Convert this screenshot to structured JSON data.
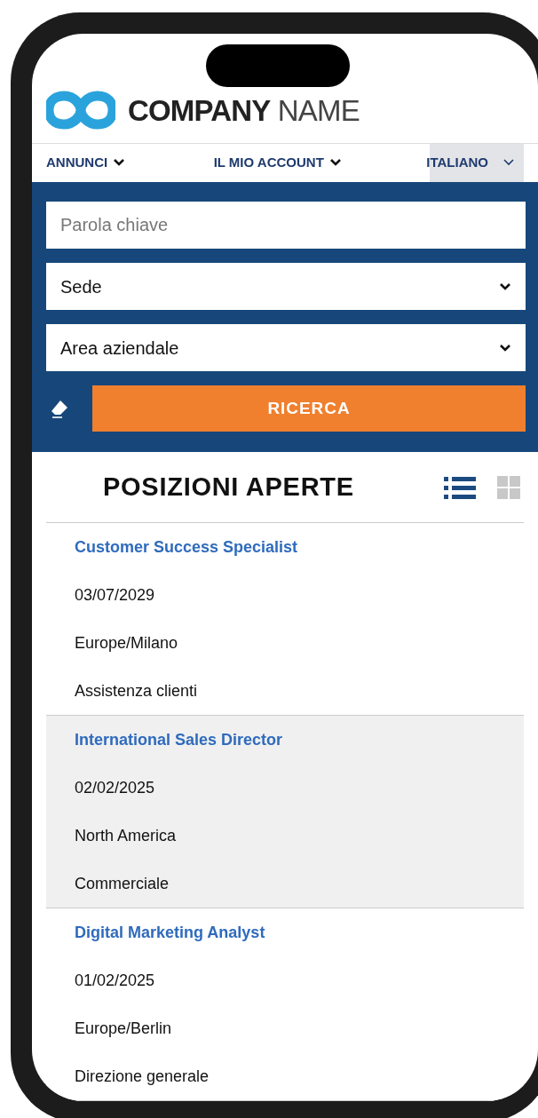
{
  "logo": {
    "bold": "COMPANY",
    "light": "NAME"
  },
  "nav": [
    {
      "label": "ANNUNCI",
      "kind": "menu"
    },
    {
      "label": "IL MIO ACCOUNT",
      "kind": "menu"
    },
    {
      "label": "ITALIANO",
      "kind": "select"
    }
  ],
  "search": {
    "keyword": {
      "placeholder": "Parola chiave"
    },
    "filters": [
      "Sede",
      "Area aziendale"
    ],
    "button": "RICERCA"
  },
  "section": {
    "title": "POSIZIONI APERTE",
    "views": [
      {
        "kind": "list",
        "selected": true
      },
      {
        "kind": "grid",
        "selected": false
      }
    ]
  },
  "jobs": [
    {
      "title": "Customer Success Specialist",
      "date": "03/07/2029",
      "location": "Europe/Milano",
      "area": "Assistenza clienti",
      "selected": false
    },
    {
      "title": "International Sales Director",
      "date": "02/02/2025",
      "location": "North America",
      "area": "Commerciale",
      "selected": true
    },
    {
      "title": "Digital Marketing Analyst",
      "date": "01/02/2025",
      "location": "Europe/Berlin",
      "area": "Direzione generale",
      "selected": false
    }
  ]
}
